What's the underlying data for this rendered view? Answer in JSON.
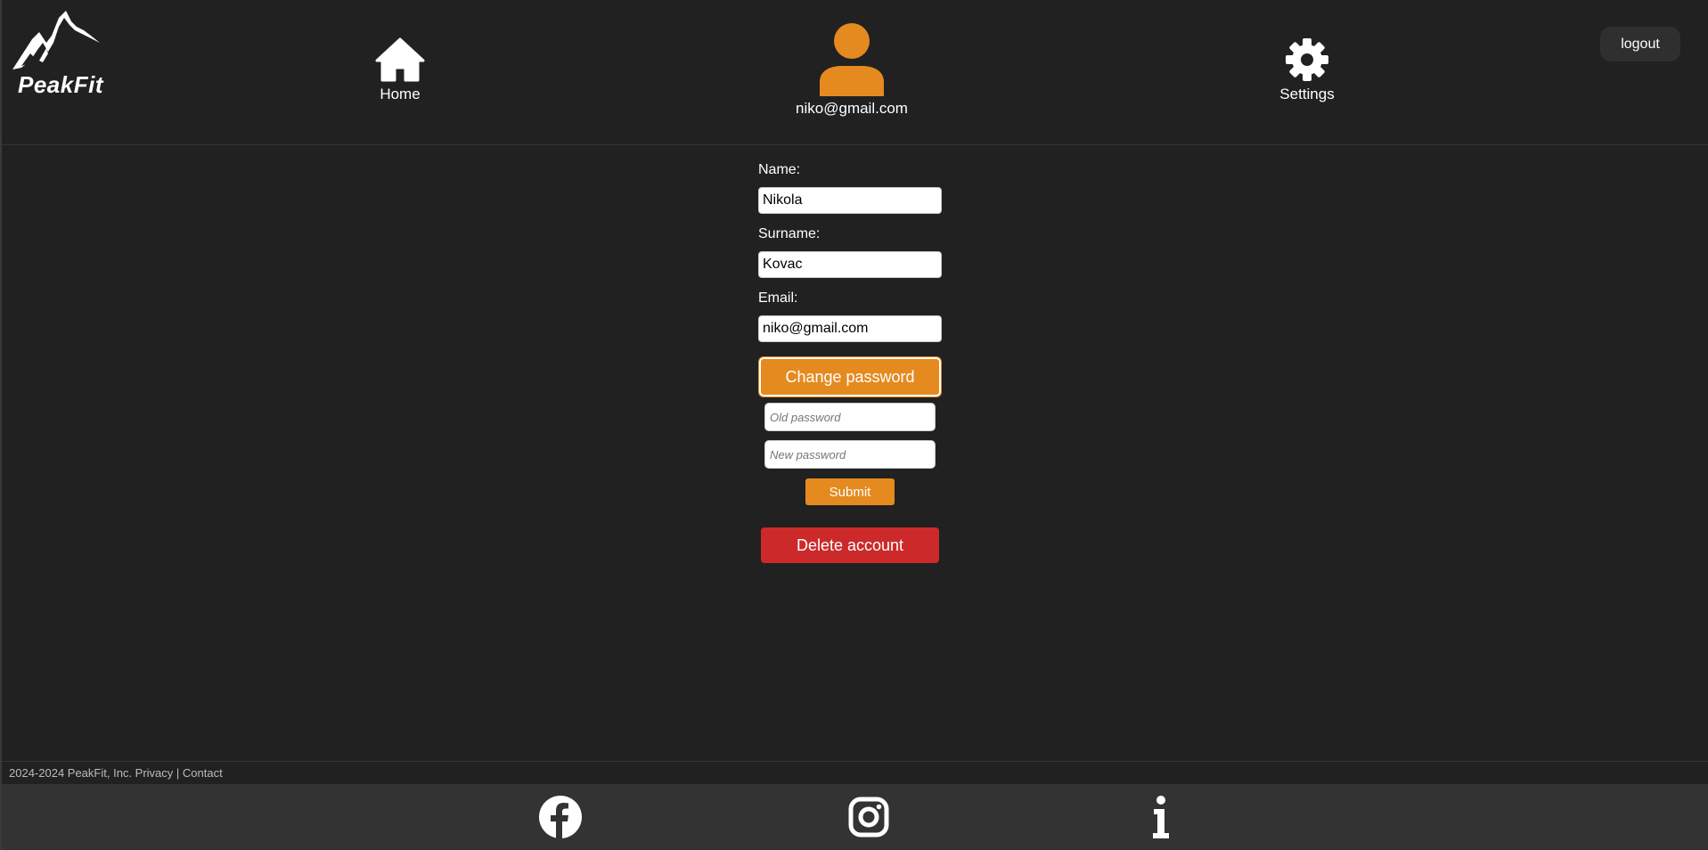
{
  "brand": {
    "name": "PeakFit"
  },
  "nav": {
    "home_label": "Home",
    "profile_label": "niko@gmail.com",
    "settings_label": "Settings",
    "logout_label": "logout"
  },
  "form": {
    "name_label": "Name:",
    "name_value": "Nikola",
    "surname_label": "Surname:",
    "surname_value": "Kovac",
    "email_label": "Email:",
    "email_value": "niko@gmail.com",
    "change_password_label": "Change password",
    "old_password_placeholder": "Old password",
    "new_password_placeholder": "New password",
    "submit_label": "Submit",
    "delete_label": "Delete account"
  },
  "footer": {
    "copyright": "2024-2024 PeakFit, Inc.",
    "privacy_label": "Privacy",
    "separator": "|",
    "contact_label": "Contact",
    "social_icons": [
      "facebook-icon",
      "instagram-icon",
      "info-icon"
    ]
  },
  "colors": {
    "background": "#212121",
    "accent": "#e58a1f",
    "danger": "#cc2a2a",
    "footer_bar": "#333333"
  }
}
